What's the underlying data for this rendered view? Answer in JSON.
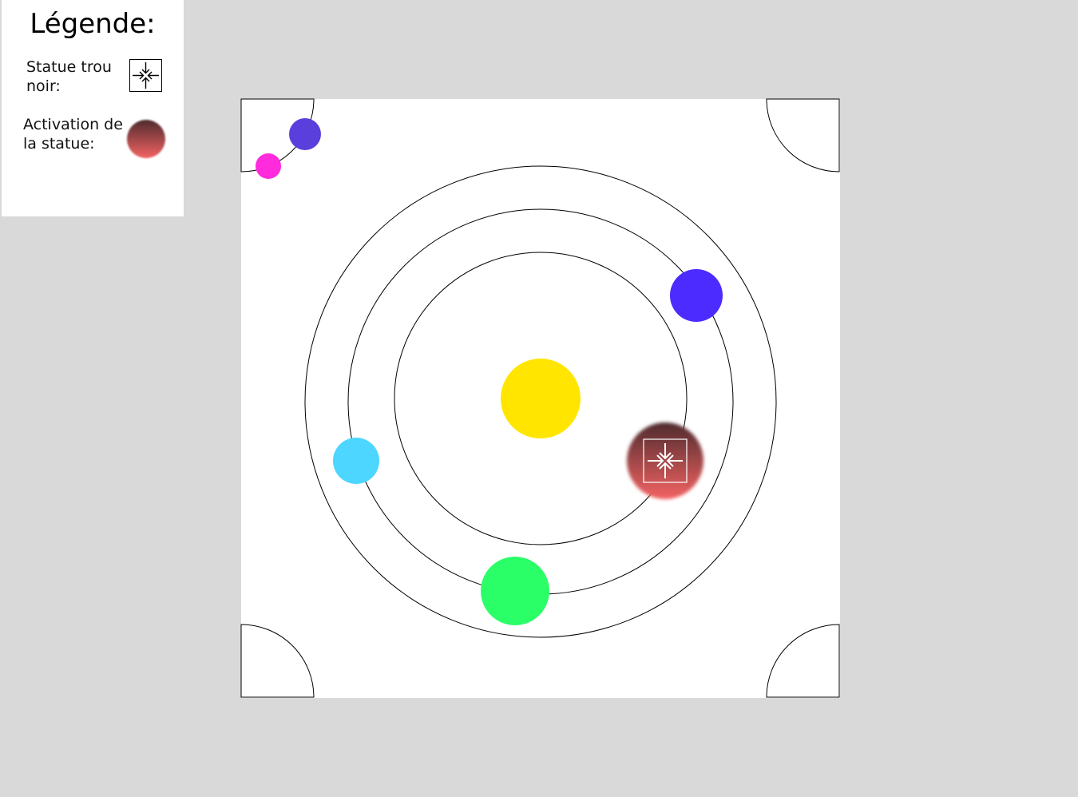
{
  "legend": {
    "title": "Légende:",
    "black_hole_statue_label": "Statue trou noir:",
    "statue_activation_label": "Activation de la statue:",
    "icons": [
      "black-hole-statue-icon",
      "statue-activation-icon"
    ]
  },
  "colors": {
    "sun": "#ffe500",
    "planet_blue": "#4b2bff",
    "planet_cyan": "#4dd6ff",
    "planet_green": "#2bff68",
    "moon_purple": "#5b3fdc",
    "moon_pink": "#ff2bdc",
    "activation_top": "#4f2b2e",
    "activation_bottom": "#f36363"
  }
}
